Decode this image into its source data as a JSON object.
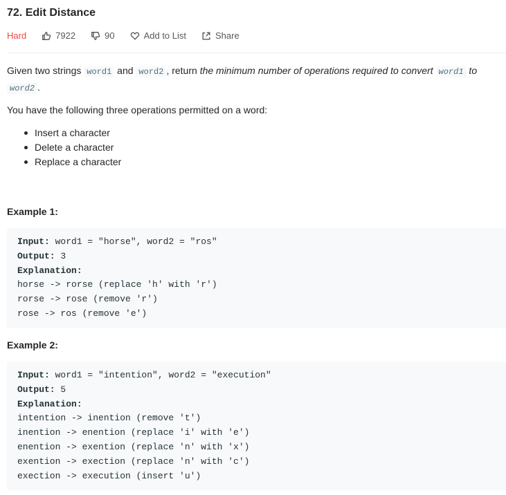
{
  "problem": {
    "title": "72. Edit Distance",
    "difficulty": "Hard",
    "likes": "7922",
    "dislikes": "90",
    "add_to_list": "Add to List",
    "share": "Share"
  },
  "description": {
    "p1_a": "Given two strings ",
    "word1": "word1",
    "p1_b": " and ",
    "word2": "word2",
    "p1_c": ", return ",
    "p1_em": "the minimum number of operations required to convert ",
    "p1_em_to": " to ",
    "p1_end": ".",
    "p2": "You have the following three operations permitted on a word:",
    "operations": [
      "Insert a character",
      "Delete a character",
      "Replace a character"
    ]
  },
  "examples": [
    {
      "title": "Example 1:",
      "input_label": "Input:",
      "input": " word1 = \"horse\", word2 = \"ros\"",
      "output_label": "Output:",
      "output": " 3",
      "explanation_label": "Explanation:",
      "steps": [
        "horse -> rorse (replace 'h' with 'r')",
        "rorse -> rose (remove 'r')",
        "rose -> ros (remove 'e')"
      ]
    },
    {
      "title": "Example 2:",
      "input_label": "Input:",
      "input": " word1 = \"intention\", word2 = \"execution\"",
      "output_label": "Output:",
      "output": " 5",
      "explanation_label": "Explanation:",
      "steps": [
        "intention -> inention (remove 't')",
        "inention -> enention (replace 'i' with 'e')",
        "enention -> exention (replace 'n' with 'x')",
        "exention -> exection (replace 'n' with 'c')",
        "exection -> execution (insert 'u')"
      ]
    }
  ]
}
